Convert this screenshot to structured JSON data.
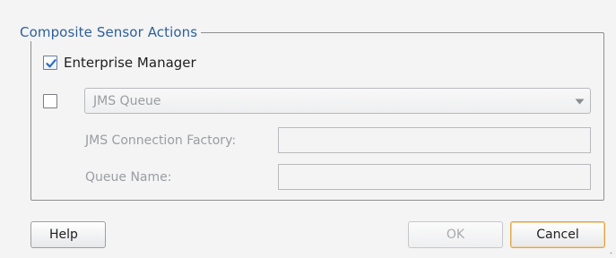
{
  "group": {
    "title": "Composite Sensor Actions"
  },
  "enterprise_manager": {
    "label": "Enterprise Manager",
    "checked": true
  },
  "jms": {
    "enabled": false,
    "queue_select": {
      "selected": "JMS Queue"
    },
    "connection_factory": {
      "label": "JMS Connection Factory:",
      "value": ""
    },
    "queue_name": {
      "label": "Queue Name:",
      "value": ""
    }
  },
  "buttons": {
    "help": "Help",
    "ok": "OK",
    "cancel": "Cancel"
  },
  "colors": {
    "legend": "#2d5f9a",
    "checkmark": "#2f6cc0",
    "cancel_border": "#e0a542",
    "disabled_text": "#9a9da1"
  },
  "icons": {
    "checkmark": "checkmark-icon",
    "dropdown": "chevron-down-icon"
  }
}
